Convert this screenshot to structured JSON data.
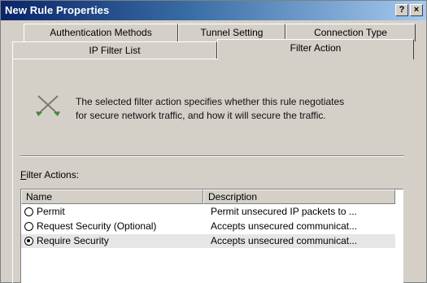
{
  "window": {
    "title": "New Rule Properties",
    "help_label": "?",
    "close_label": "×"
  },
  "tabs": {
    "row1": [
      "Authentication Methods",
      "Tunnel Setting",
      "Connection Type"
    ],
    "row2": [
      "IP Filter List",
      "Filter Action"
    ],
    "active": "Filter Action"
  },
  "info": {
    "icon": "filter-action-icon",
    "text_line1": "The selected filter action specifies whether this rule negotiates",
    "text_line2": "for secure network traffic, and how it will secure the traffic."
  },
  "filter_actions": {
    "label_accel": "F",
    "label_rest": "ilter Actions:",
    "columns": [
      "Name",
      "Description"
    ],
    "rows": [
      {
        "name": "Permit",
        "description": "Permit unsecured IP packets to ...",
        "selected": false
      },
      {
        "name": "Request Security (Optional)",
        "description": "Accepts unsecured communicat...",
        "selected": false
      },
      {
        "name": "Require Security",
        "description": "Accepts unsecured communicat...",
        "selected": true
      }
    ]
  },
  "colors": {
    "title_start": "#0a246a",
    "title_end": "#a6caf0",
    "face": "#d4d0c8",
    "selected_row": "#e6e6e6"
  }
}
